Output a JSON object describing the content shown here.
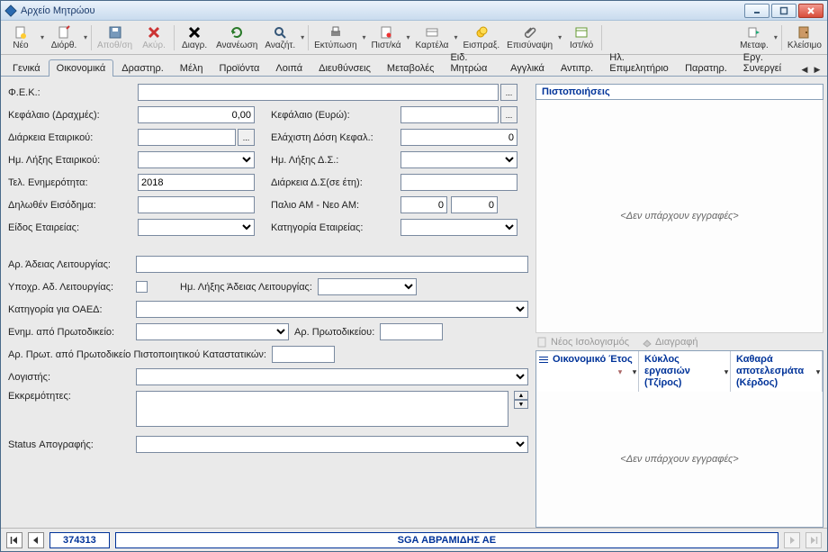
{
  "window": {
    "title": "Αρχείο Μητρώου"
  },
  "toolbar": [
    {
      "label": "Νέο",
      "svg": "doc-new",
      "drop": true
    },
    {
      "label": "Διόρθ.",
      "svg": "edit",
      "drop": true
    },
    {
      "label": "Αποθ/ση",
      "svg": "save",
      "disabled": true,
      "drop": false
    },
    {
      "label": "Ακύρ.",
      "svg": "cancel",
      "disabled": true,
      "drop": false
    },
    {
      "label": "Διαγρ.",
      "svg": "del",
      "drop": false
    },
    {
      "label": "Ανανέωση",
      "svg": "refresh",
      "drop": false
    },
    {
      "label": "Αναζήτ.",
      "svg": "search",
      "drop": true
    },
    {
      "label": "Εκτύπωση",
      "svg": "print",
      "drop": true
    },
    {
      "label": "Πιστ/κά",
      "svg": "cert",
      "drop": true
    },
    {
      "label": "Καρτέλα",
      "svg": "card",
      "drop": true
    },
    {
      "label": "Εισπραξ.",
      "svg": "coin",
      "drop": false
    },
    {
      "label": "Επισύναψη",
      "svg": "attach",
      "drop": true
    },
    {
      "label": "Ιστ/κό",
      "svg": "hist",
      "drop": false
    },
    {
      "label": "Μεταφ.",
      "svg": "move",
      "drop": true
    },
    {
      "label": "Κλείσιμο",
      "svg": "close",
      "drop": false
    }
  ],
  "tabs": [
    "Γενικά",
    "Οικονομικά",
    "Δραστηρ.",
    "Μέλη",
    "Προϊόντα",
    "Λοιπά",
    "Διευθύνσεις",
    "Μεταβολές",
    "Ειδ. Μητρώα",
    "Αγγλικά",
    "Αντιπρ.",
    "Ηλ. Επιμελητήριο",
    "Παρατηρ.",
    "Εργ. Συνεργεί"
  ],
  "tabs_selected": 1,
  "form": {
    "fek": {
      "label": "Φ.Ε.Κ.:",
      "value": ""
    },
    "kefalaio_drx": {
      "label": "Κεφάλαιο (Δραχμές):",
      "value": "0,00"
    },
    "kefalaio_eur": {
      "label": "Κεφάλαιο (Ευρώ):",
      "value": ""
    },
    "diarkeia_et": {
      "label": "Διάρκεια Εταιρικού:",
      "value": ""
    },
    "min_dosi": {
      "label": "Ελάχιστη Δόση Κεφαλ.:",
      "value": "0"
    },
    "lixi_et": {
      "label": "Ημ. Λήξης Εταιρικού:",
      "value": ""
    },
    "lixi_ds": {
      "label": "Ημ. Λήξης Δ.Σ.:",
      "value": ""
    },
    "tel_enim": {
      "label": "Τελ. Ενημερότητα:",
      "value": "2018"
    },
    "diarkeia_ds": {
      "label": "Διάρκεια Δ.Σ(σε έτη):",
      "value": ""
    },
    "eisodima": {
      "label": "Δηλωθέν Εισόδημα:",
      "value": ""
    },
    "palio_am": {
      "label": "Παλιο ΑΜ - Νεο ΑΜ:",
      "v1": "0",
      "v2": "0"
    },
    "eidos": {
      "label": "Είδος Εταιρείας:",
      "value": ""
    },
    "kathg": {
      "label": "Κατηγορία Εταιρείας:",
      "value": ""
    },
    "ar_adeias": {
      "label": "Αρ. Άδειας Λειτουργίας:",
      "value": ""
    },
    "ypoxr": {
      "label": "Υποχρ. Αδ. Λειτουργίας:",
      "checked": false
    },
    "lixi_adeias": {
      "label": "Ημ. Λήξης Άδειας Λειτουργίας:",
      "value": ""
    },
    "oaed": {
      "label": "Κατηγορία για ΟΑΕΔ:",
      "value": ""
    },
    "enim_proto": {
      "label": "Ενημ. από Πρωτοδικείο:",
      "value": ""
    },
    "ar_proto": {
      "label": "Αρ. Πρωτοδικείου:",
      "value": ""
    },
    "ar_prot_long": {
      "label": "Αρ. Πρωτ. από Πρωτοδικείο Πιστοποιητικού Καταστατικών:",
      "value": ""
    },
    "logistis": {
      "label": "Λογιστής:",
      "value": ""
    },
    "ekkrem": {
      "label": "Εκκρεμότητες:",
      "value": ""
    },
    "status": {
      "label": "Status Απογραφής:",
      "value": ""
    }
  },
  "cert_panel": {
    "title": "Πιστοποιήσεις",
    "empty": "<Δεν υπάρχουν εγγραφές>"
  },
  "balance_tools": {
    "new": "Νέος Ισολογισμός",
    "del": "Διαγραφή"
  },
  "balance_table": {
    "cols": [
      "Οικονομικό Έτος",
      "Κύκλος εργασιών (Τζίρος)",
      "Καθαρά αποτελεσμάτα (Κέρδος)"
    ],
    "empty": "<Δεν υπάρχουν εγγραφές>"
  },
  "footer": {
    "record": "374313",
    "title": "SGA ΑΒΡΑΜΙΔΗΣ ΑΕ"
  }
}
